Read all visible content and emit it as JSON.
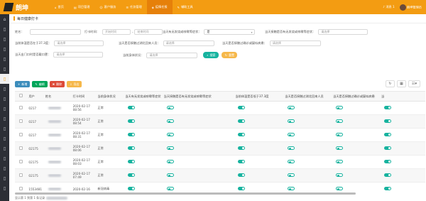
{
  "topbar": {
    "logo_text": "朗坤",
    "nav": [
      {
        "label": "首页",
        "icon": "home-icon",
        "glyph": "⌂"
      },
      {
        "label": "项目管理",
        "icon": "clipboard-icon",
        "glyph": "▤"
      },
      {
        "label": "客户服务",
        "icon": "user-icon",
        "glyph": "☺"
      },
      {
        "label": "任务管理",
        "icon": "list-icon",
        "glyph": "☰"
      },
      {
        "label": "疫情任报",
        "icon": "shield-icon",
        "glyph": "◈"
      },
      {
        "label": "辅助工具",
        "icon": "wrench-icon",
        "glyph": "✎"
      }
    ],
    "notice": "消息 1",
    "user": "朗坤管理员"
  },
  "sidebar_icons": [
    "home-icon",
    "document-icon",
    "document-icon",
    "document-icon",
    "document-icon",
    "document-icon",
    "document-icon",
    "document-icon",
    "document-icon",
    "document-icon",
    "document-icon",
    "document-icon",
    "document-icon",
    "document-icon",
    "document-icon",
    "document-icon",
    "document-icon",
    "document-icon"
  ],
  "page_title": "每日健康打卡",
  "filters": {
    "name_label": "姓名：",
    "time_label": "打卡时间：",
    "time_start": "开始时间",
    "time_sep": "-",
    "time_end": "结束时间",
    "fever_label": "当天有无发烧或咳嗽等症状：",
    "fever_value": "是",
    "contact_label": "当天接触是否有无发烧或咳嗽等症状：",
    "contact_value": "请选择",
    "temp_label": "当前体温是否在于37.3度：",
    "temp_value": "请选择",
    "hubei_label": "当天是否接触过湖北回来人员：",
    "hubei_value": "请选择",
    "quarantine_label": "当天是否接触过确诊或疑似病患：",
    "quarantine_value": "请选择",
    "gate_label": "当天出门口时是否戴口罩：",
    "gate_value": "请选择",
    "body_label": "当前身体状况：",
    "body_value": "请选择",
    "search_btn": "搜索",
    "reset_btn": "重置"
  },
  "toolbar": {
    "add": "新增",
    "edit": "编辑",
    "delete": "删除",
    "export": "导出"
  },
  "table": {
    "headers": [
      "用户",
      "姓名",
      "打卡时间",
      "当前身体状况",
      "当天有无发烧或咳嗽等症状",
      "当天接触是否有无发烧或咳嗽等症状",
      "当前体温是否低于37.3度",
      "当天是否接触过湖北回来人员",
      "当天是否接触过确诊或疑似病患",
      "当"
    ],
    "rows": [
      {
        "user": "0217",
        "date": "2020-02-17",
        "time": "08:56",
        "status": "正常",
        "t": [
          1,
          0,
          1,
          0,
          0,
          1
        ]
      },
      {
        "user": "0217",
        "date": "2020-02-17",
        "time": "08:54",
        "status": "正常",
        "t": [
          1,
          0,
          1,
          0,
          0,
          1
        ]
      },
      {
        "user": "0217",
        "date": "2020-02-17",
        "time": "08:31",
        "status": "正常",
        "t": [
          1,
          0,
          1,
          0,
          0,
          1
        ]
      },
      {
        "user": "02175",
        "date": "2020-02-17",
        "time": "08:06",
        "status": "正常",
        "t": [
          1,
          0,
          1,
          0,
          0,
          1
        ]
      },
      {
        "user": "02175",
        "date": "2020-02-17",
        "time": "08:03",
        "status": "正常",
        "t": [
          1,
          0,
          1,
          0,
          0,
          1
        ]
      },
      {
        "user": "02175",
        "date": "2020-02-17",
        "time": "07:49",
        "status": "正常",
        "t": [
          1,
          0,
          1,
          0,
          0,
          1
        ]
      },
      {
        "user": "1553481",
        "date": "2020-02-16",
        "time": "",
        "status": "新冠病毒",
        "t": [
          1,
          0,
          1,
          0,
          0,
          1
        ]
      }
    ]
  },
  "footer": {
    "text": "显示第 1 到第 1 条记录"
  },
  "colors": {
    "brand": "#f39c12",
    "teal": "#17b39f",
    "blue": "#3c8dbc",
    "green": "#00a65a",
    "red": "#dd4b39",
    "orange": "#f39c12"
  }
}
